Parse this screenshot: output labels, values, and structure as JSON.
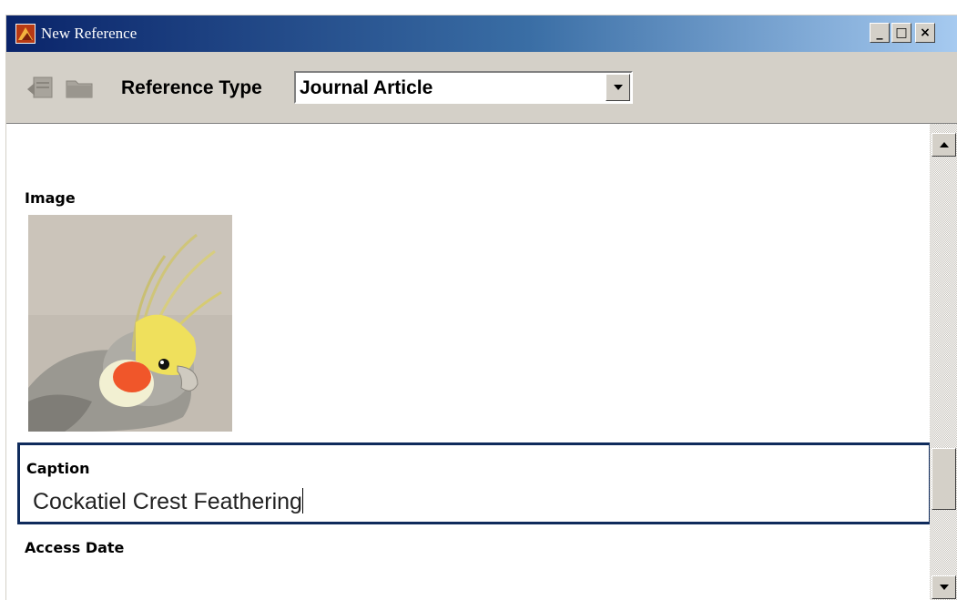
{
  "window": {
    "title": "New Reference",
    "controls": {
      "minimize": "_",
      "maximize": "□",
      "close": "×"
    }
  },
  "toolbar": {
    "buttons": [
      {
        "icon": "back-document-icon"
      },
      {
        "icon": "folder-icon"
      }
    ],
    "reference_type_label": "Reference Type",
    "reference_type_value": "Journal Article"
  },
  "fields": {
    "image_label": "Image",
    "image_subject": "cockatiel",
    "caption_label": "Caption",
    "caption_value": "Cockatiel Crest Feathering",
    "access_date_label": "Access Date"
  },
  "colors": {
    "title_bar_start": "#0a246a",
    "title_bar_end": "#a6caf0",
    "caption_border": "#0f2b5c",
    "chrome": "#d4d0c8"
  }
}
